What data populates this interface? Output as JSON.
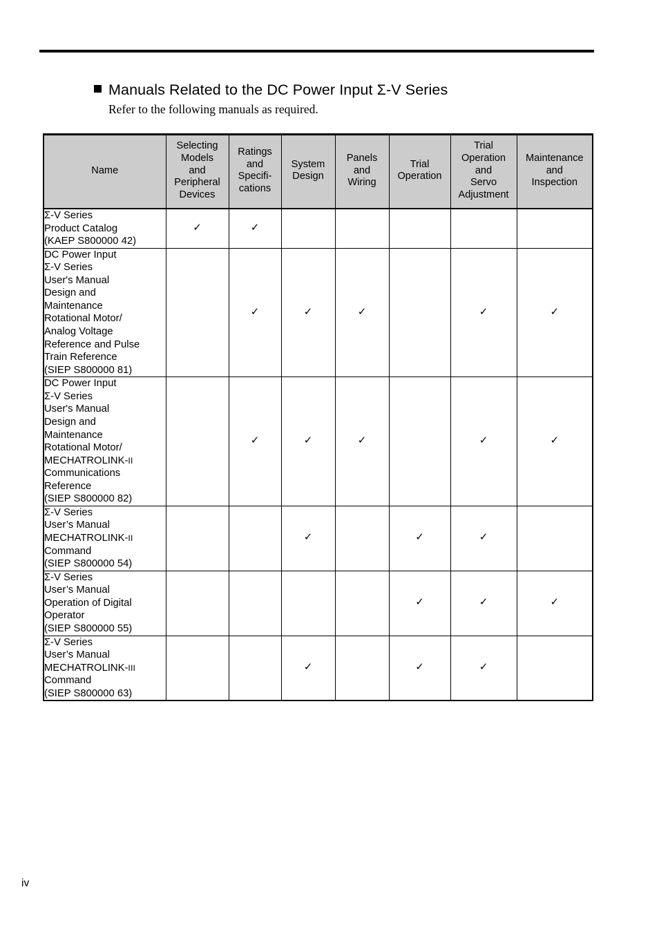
{
  "heading": {
    "bullet_icon": "black-square-bullet",
    "title": "Manuals Related to the DC Power Input Σ-V Series",
    "subtitle": "Refer to the following manuals as required."
  },
  "table": {
    "columns": [
      "Name",
      "Selecting\nModels\nand\nPeripheral\nDevices",
      "Ratings\nand\nSpecifi-\ncations",
      "System\nDesign",
      "Panels\nand\nWiring",
      "Trial\nOperation",
      "Trial\nOperation\nand\nServo\nAdjustment",
      "Maintenance\nand\nInspection"
    ],
    "check_glyph": "✓",
    "rows": [
      {
        "name": "Σ-V Series\nProduct Catalog\n(KAEP S800000 42)",
        "checks": [
          true,
          true,
          false,
          false,
          false,
          false,
          false
        ]
      },
      {
        "name": "DC Power Input\nΣ-V Series\nUser's Manual\nDesign and\nMaintenance\nRotational Motor/\nAnalog Voltage\nReference and Pulse\nTrain Reference\n(SIEP S800000 81)",
        "checks": [
          false,
          true,
          true,
          true,
          false,
          true,
          true
        ]
      },
      {
        "name_pre": "DC Power Input\nΣ-V Series\nUser's Manual\nDesign and\nMaintenance\nRotational Motor/\nMECHATROLINK-",
        "name_smallcap": "II",
        "name_post": "\nCommunications\nReference\n(SIEP S800000 82)",
        "checks": [
          false,
          true,
          true,
          true,
          false,
          true,
          true
        ]
      },
      {
        "name_pre": "Σ-V Series\nUser’s Manual\nMECHATROLINK-",
        "name_smallcap": "II",
        "name_post": "\nCommand\n(SIEP S800000 54)",
        "checks": [
          false,
          false,
          true,
          false,
          true,
          true,
          false
        ]
      },
      {
        "name": "Σ-V Series\nUser’s Manual\nOperation of Digital\nOperator\n(SIEP S800000 55)",
        "checks": [
          false,
          false,
          false,
          false,
          true,
          true,
          true
        ]
      },
      {
        "name_pre": "Σ-V Series\nUser’s Manual\nMECHATROLINK-",
        "name_smallcap": "III",
        "name_post": "\nCommand\n(SIEP S800000 63)",
        "checks": [
          false,
          false,
          true,
          false,
          true,
          true,
          false
        ]
      }
    ]
  },
  "footer": {
    "page_number": "iv"
  },
  "colors": {
    "header_fill": "#cccccc",
    "rule": "#000000",
    "text": "#000000"
  }
}
